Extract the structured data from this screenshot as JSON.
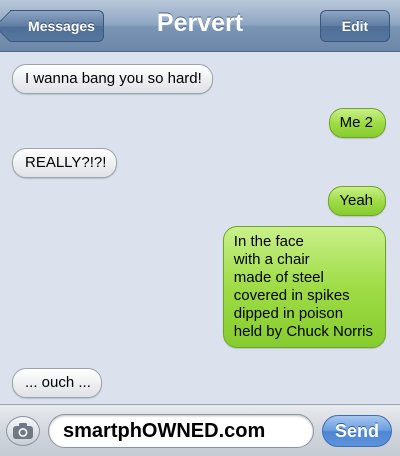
{
  "nav": {
    "back_label": "Messages",
    "title": "Pervert",
    "edit_label": "Edit"
  },
  "messages": [
    {
      "from": "them",
      "lines": [
        "I wanna bang you so hard!"
      ]
    },
    {
      "from": "me",
      "lines": [
        "Me 2"
      ]
    },
    {
      "from": "them",
      "lines": [
        "REALLY?!?!"
      ]
    },
    {
      "from": "me",
      "lines": [
        "Yeah"
      ]
    },
    {
      "from": "me",
      "lines": [
        "In the face",
        "with a chair",
        "made of steel",
        "covered in spikes",
        "dipped in poison",
        "held by Chuck Norris"
      ]
    },
    {
      "from": "them",
      "lines": [
        "... ouch ..."
      ]
    }
  ],
  "composer": {
    "value": "smartphOWNED.com",
    "send_label": "Send",
    "camera_icon": "camera-icon"
  },
  "colors": {
    "background": "#dbe2ed",
    "outgoing_bubble": "#9fdc46",
    "incoming_bubble": "#eef0f3",
    "send_button": "#5d93dc"
  }
}
